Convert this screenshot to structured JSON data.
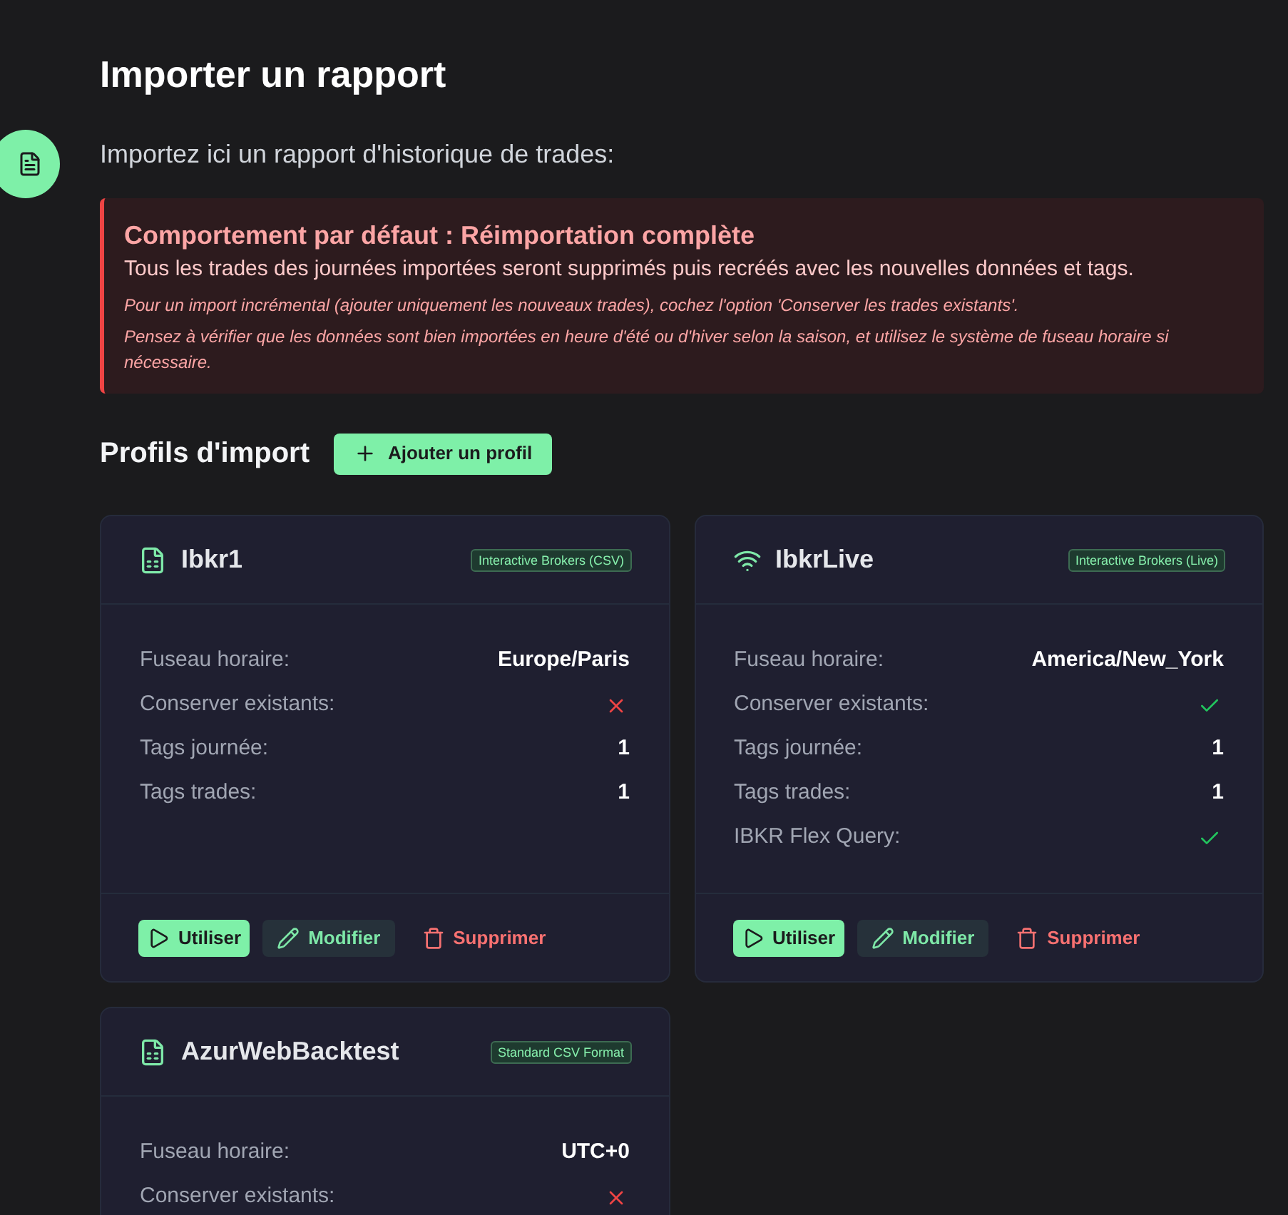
{
  "page": {
    "title": "Importer un rapport",
    "subtitle": "Importez ici un rapport d'historique de trades:"
  },
  "alert": {
    "title": "Comportement par défaut : Réimportation complète",
    "text": "Tous les trades des journées importées seront supprimés puis recréés avec les nouvelles données et tags.",
    "notes": [
      "Pour un import incrémental (ajouter uniquement les nouveaux trades), cochez l'option 'Conserver les trades existants'.",
      "Pensez à vérifier que les données sont bien importées en heure d'été ou d'hiver selon la saison, et utilisez le système de fuseau horaire si nécessaire."
    ]
  },
  "profiles": {
    "title": "Profils d'import",
    "add_button": "Ajouter un profil",
    "cards": [
      {
        "name": "Ibkr1",
        "kind": "file",
        "badge": "Interactive Brokers (CSV)",
        "rows": [
          {
            "label": "Fuseau horaire:",
            "kind": "text",
            "value": "Europe/Paris"
          },
          {
            "label": "Conserver existants:",
            "kind": "bool",
            "checked": false
          },
          {
            "label": "Tags journée:",
            "kind": "text",
            "value": "1"
          },
          {
            "label": "Tags trades:",
            "kind": "text",
            "value": "1"
          }
        ],
        "actions": [
          {
            "label": "Utiliser",
            "kind": "use"
          },
          {
            "label": "Modifier",
            "kind": "edit"
          },
          {
            "label": "Supprimer",
            "kind": "delete"
          }
        ]
      },
      {
        "name": "IbkrLive",
        "kind": "live",
        "badge": "Interactive Brokers (Live)",
        "rows": [
          {
            "label": "Fuseau horaire:",
            "kind": "text",
            "value": "America/New_York"
          },
          {
            "label": "Conserver existants:",
            "kind": "bool",
            "checked": true
          },
          {
            "label": "Tags journée:",
            "kind": "text",
            "value": "1"
          },
          {
            "label": "Tags trades:",
            "kind": "text",
            "value": "1"
          },
          {
            "label": "IBKR Flex Query:",
            "kind": "bool",
            "checked": true
          }
        ],
        "actions": [
          {
            "label": "Utiliser",
            "kind": "use"
          },
          {
            "label": "Modifier",
            "kind": "edit"
          },
          {
            "label": "Supprimer",
            "kind": "delete"
          }
        ]
      },
      {
        "name": "AzurWebBacktest",
        "kind": "file",
        "badge": "Standard CSV Format",
        "rows": [
          {
            "label": "Fuseau horaire:",
            "kind": "text",
            "value": "UTC+0"
          },
          {
            "label": "Conserver existants:",
            "kind": "bool",
            "checked": false
          }
        ]
      }
    ]
  }
}
